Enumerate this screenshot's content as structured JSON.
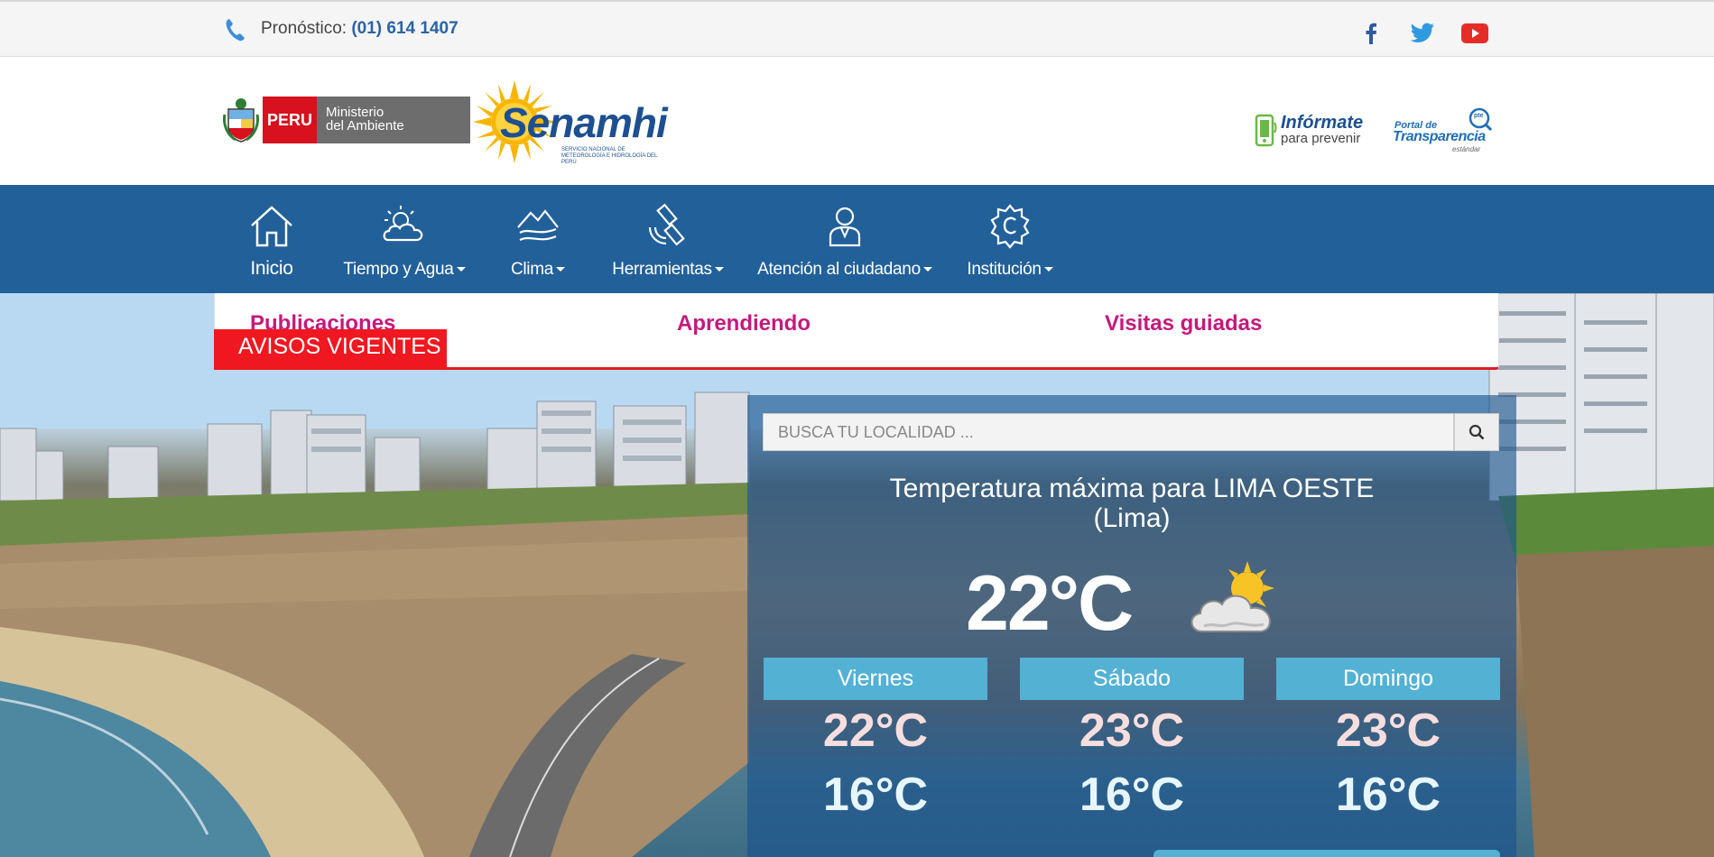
{
  "topbar": {
    "phone_label": "Pronóstico:",
    "phone_number": "(01) 614 1407",
    "social": [
      "facebook-icon",
      "twitter-icon",
      "youtube-icon"
    ]
  },
  "header": {
    "peru": "PERU",
    "ministry_line1": "Ministerio",
    "ministry_line2": "del Ambiente",
    "brand": "Senamhi",
    "brand_sub": "SERVICIO NACIONAL DE METEOROLOGÍA E HIDROLOGÍA DEL PERÚ",
    "informate_title": "Infórmate",
    "informate_sub": "para prevenir",
    "transparencia_top": "Portal de",
    "transparencia_main": "Transparencia",
    "transparencia_sub": "estándar",
    "transparencia_badge": "pte"
  },
  "nav": {
    "items": [
      {
        "label": "Inicio",
        "icon": "home-icon"
      },
      {
        "label": "Tiempo y Agua",
        "icon": "weather-icon"
      },
      {
        "label": "Clima",
        "icon": "climate-icon"
      },
      {
        "label": "Herramientas",
        "icon": "satellite-icon"
      },
      {
        "label": "Atención al ciudadano",
        "icon": "citizen-icon"
      },
      {
        "label": "Institución",
        "icon": "institution-icon"
      }
    ]
  },
  "submenu": {
    "items": [
      "Publicaciones",
      "Aprendiendo",
      "Visitas guiadas"
    ],
    "alerts": "AVISOS VIGENTES"
  },
  "weather": {
    "search_placeholder": "BUSCA TU LOCALIDAD ...",
    "title_line1": "Temperatura máxima para LIMA OESTE",
    "title_line2": "(Lima)",
    "current_temp": "22°C",
    "current_icon": "partly-cloudy-icon",
    "forecast": [
      {
        "day": "Viernes",
        "max": "22°C",
        "min": "16°C"
      },
      {
        "day": "Sábado",
        "max": "23°C",
        "min": "16°C"
      },
      {
        "day": "Domingo",
        "max": "23°C",
        "min": "16°C"
      }
    ]
  },
  "colors": {
    "nav_bg": "#22609a",
    "accent_magenta": "#c5197d",
    "alert_red": "#ef1820",
    "forecast_head": "#53b1d4"
  }
}
